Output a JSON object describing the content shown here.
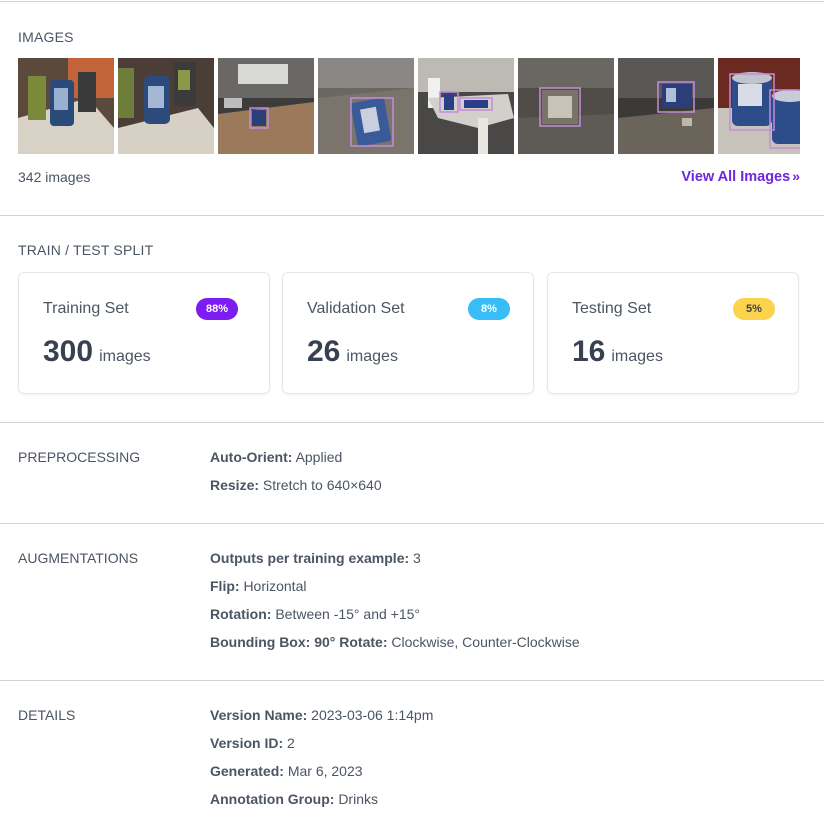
{
  "images": {
    "title": "IMAGES",
    "count_text": "342 images",
    "view_all_label": "View All Images",
    "thumbnails": [
      {
        "name": "thumb-1"
      },
      {
        "name": "thumb-2"
      },
      {
        "name": "thumb-3"
      },
      {
        "name": "thumb-4"
      },
      {
        "name": "thumb-5"
      },
      {
        "name": "thumb-6"
      },
      {
        "name": "thumb-7"
      },
      {
        "name": "thumb-8"
      }
    ]
  },
  "split": {
    "title": "TRAIN / TEST SPLIT",
    "cards": [
      {
        "label": "Training Set",
        "count": "300",
        "unit": "images",
        "percent": "88%",
        "badge_bg": "#7c1cf0",
        "badge_fg": "#ffffff"
      },
      {
        "label": "Validation Set",
        "count": "26",
        "unit": "images",
        "percent": "8%",
        "badge_bg": "#38bdf8",
        "badge_fg": "#ffffff"
      },
      {
        "label": "Testing Set",
        "count": "16",
        "unit": "images",
        "percent": "5%",
        "badge_bg": "#fcd34d",
        "badge_fg": "#3f3f46"
      }
    ]
  },
  "preprocessing": {
    "title": "PREPROCESSING",
    "rows": [
      {
        "key": "Auto-Orient:",
        "value": "Applied"
      },
      {
        "key": "Resize:",
        "value": "Stretch to 640×640"
      }
    ]
  },
  "augmentations": {
    "title": "AUGMENTATIONS",
    "rows": [
      {
        "key": "Outputs per training example:",
        "value": "3"
      },
      {
        "key": "Flip:",
        "value": "Horizontal"
      },
      {
        "key": "Rotation:",
        "value": "Between -15° and +15°"
      },
      {
        "key": "Bounding Box: 90° Rotate:",
        "value": "Clockwise, Counter-Clockwise"
      }
    ]
  },
  "details": {
    "title": "DETAILS",
    "rows": [
      {
        "key": "Version Name:",
        "value": "2023-03-06 1:14pm"
      },
      {
        "key": "Version ID:",
        "value": "2"
      },
      {
        "key": "Generated:",
        "value": "Mar 6, 2023"
      },
      {
        "key": "Annotation Group:",
        "value": "Drinks"
      }
    ]
  },
  "colors": {
    "accent": "#6d28d9",
    "divider": "#d1d5db",
    "text": "#4b5563",
    "heading_number": "#374151"
  }
}
